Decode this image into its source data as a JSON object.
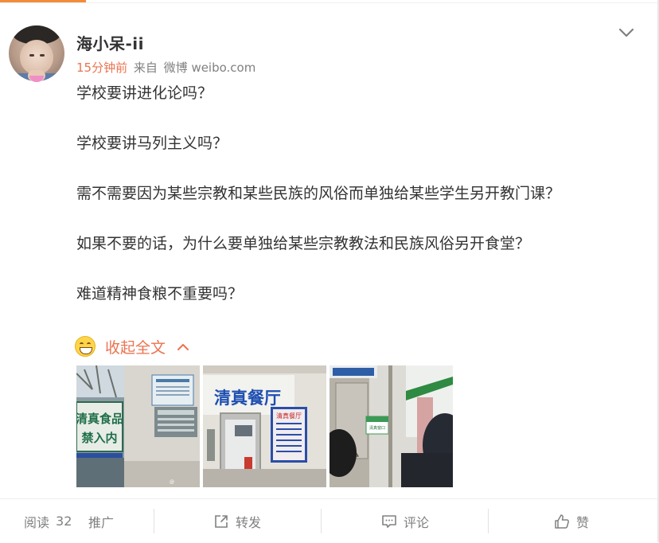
{
  "user": {
    "name": "海小呆-ii",
    "time": "15分钟前",
    "source_prefix": "来自",
    "source": "微博 weibo.com"
  },
  "post": {
    "lines": [
      "学校要讲进化论吗？",
      "学校要讲马列主义吗？",
      "需不需要因为某些宗教和某些民族的风俗而单独给某些学生另开教门课？",
      "如果不要的话，为什么要单独给某些宗教教法和民族风俗另开食堂？",
      "难道精神食粮不重要吗？"
    ],
    "collapse_label": "收起全文"
  },
  "images": {
    "img1": {
      "sign_text": "清真食品禁入内"
    },
    "img2": {
      "sign_text": "清真餐厅"
    },
    "img3": {
      "sign_text": "清真窗口"
    }
  },
  "actions": {
    "read_label": "阅读",
    "read_count": "32",
    "promote": "推广",
    "repost": "转发",
    "comment": "评论",
    "like": "赞"
  },
  "colors": {
    "accent": "#eb7350",
    "top_accent": "#f28c3b"
  },
  "icons": [
    "chevron-down-icon",
    "grin-emoji-icon",
    "chevron-up-icon",
    "repost-icon",
    "comment-icon",
    "like-icon"
  ]
}
